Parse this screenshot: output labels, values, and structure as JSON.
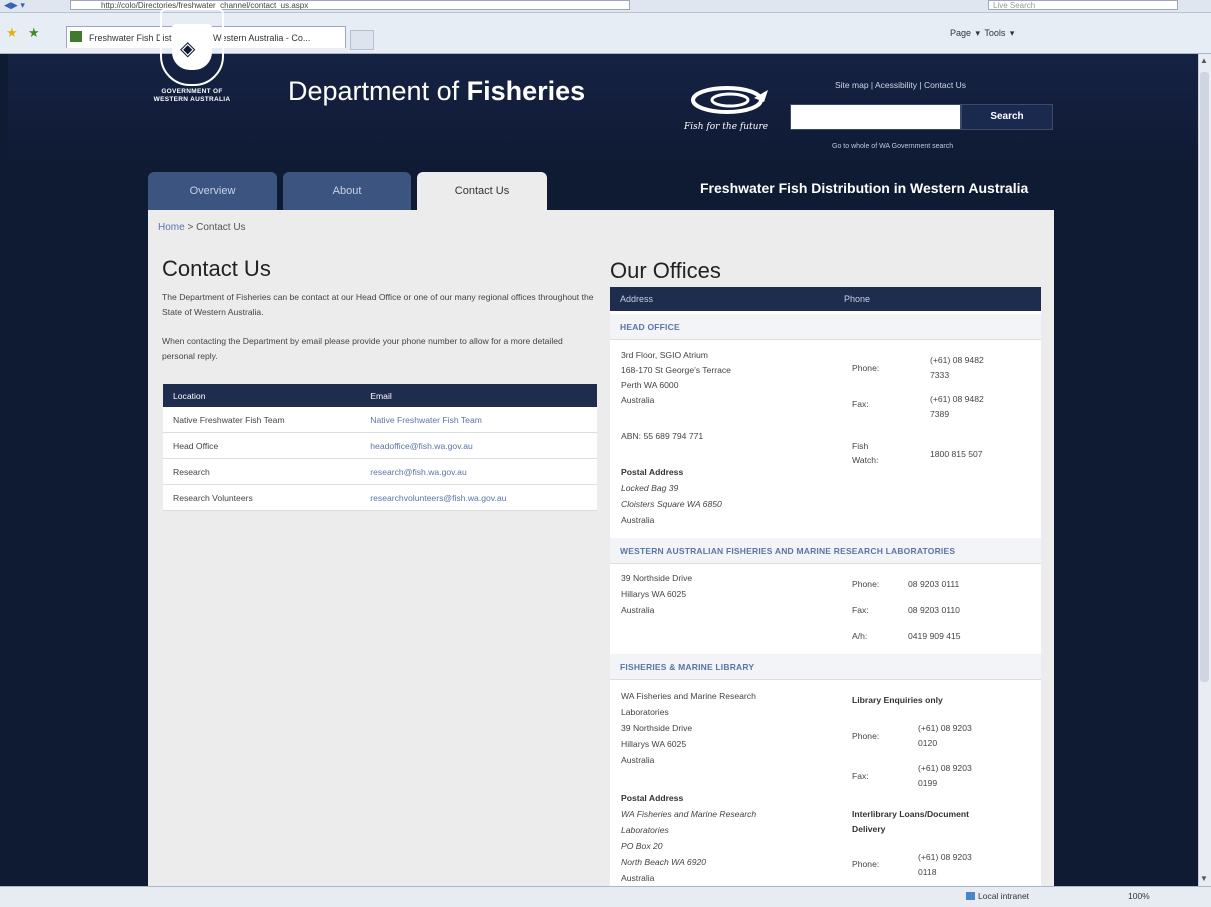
{
  "browser": {
    "url": "http://colo/Directories/freshwater_channel/contact_us.aspx",
    "live_search_placeholder": "Live Search",
    "tab_title": "Freshwater Fish Distribution in Western Australia - Co...",
    "command_bar": "Page ▾  Tools ▾",
    "status_zone": "Local intranet",
    "zoom": "100%"
  },
  "header": {
    "gov_line1": "GOVERNMENT OF",
    "gov_line2": "WESTERN AUSTRALIA",
    "dept_prefix": "Department of",
    "dept_bold": "Fisheries",
    "tagline": "Fish for the future",
    "top_links": "Site map | Acessibility | Contact Us",
    "search_button": "Search",
    "whole_gov_search": "Go to whole of WA Government search"
  },
  "nav": {
    "tabs": [
      "Overview",
      "About",
      "Contact Us"
    ],
    "site_title": "Freshwater Fish Distribution in Western Australia"
  },
  "breadcrumb": {
    "home": "Home",
    "sep": " > ",
    "current": "Contact Us"
  },
  "contact": {
    "heading": "Contact Us",
    "p1": "The Department of Fisheries can be contact at our Head Office or one of our many regional offices throughout the State of Western Australia.",
    "p2": "When contacting the Department by email please provide your phone number to allow for a more detailed personal reply.",
    "table_headers": [
      "Location",
      "Email"
    ],
    "rows": [
      [
        "Native Freshwater Fish Team",
        "Native Freshwater Fish Team"
      ],
      [
        "Head Office",
        "headoffice@fish.wa.gov.au"
      ],
      [
        "Research",
        "research@fish.wa.gov.au"
      ],
      [
        "Research Volunteers",
        "researchvolunteers@fish.wa.gov.au"
      ]
    ]
  },
  "offices": {
    "heading": "Our Offices",
    "headers": [
      "Address",
      "Phone"
    ],
    "head_office": {
      "title": "HEAD OFFICE",
      "addr": [
        "3rd Floor, SGIO Atrium",
        "168-170 St George's Terrace",
        "Perth WA 6000",
        "Australia"
      ],
      "abn": "ABN: 55 689 794 771",
      "postal_label": "Postal Address",
      "postal": [
        "Locked Bag 39",
        "Cloisters Square WA 6850"
      ],
      "postal_country": "Australia",
      "phone_label": "Phone:",
      "phone": [
        "(+61) 08 9482",
        "7333"
      ],
      "fax_label": "Fax:",
      "fax": [
        "(+61) 08 9482",
        "7389"
      ],
      "fishwatch_label": [
        "Fish",
        "Watch:"
      ],
      "fishwatch": "1800 815 507"
    },
    "labs": {
      "title": "WESTERN AUSTRALIAN FISHERIES AND MARINE RESEARCH LABORATORIES",
      "addr": [
        "39 Northside Drive",
        "Hillarys WA 6025",
        "Australia"
      ],
      "phone_label": "Phone:",
      "phone": "08 9203 0111",
      "fax_label": "Fax:",
      "fax": "08 9203 0110",
      "ah_label": "A/h:",
      "ah": "0419 909 415"
    },
    "library": {
      "title": "FISHERIES & MARINE LIBRARY",
      "addr": [
        "WA Fisheries and Marine Research",
        "Laboratories",
        "39 Northside Drive",
        "Hillarys WA 6025",
        "Australia"
      ],
      "postal_label": "Postal Address",
      "postal": [
        "WA Fisheries and Marine Research",
        "Laboratories",
        "PO Box 20",
        "North Beach WA 6920",
        "Australia"
      ],
      "enq_label": "Library Enquiries only",
      "phone_label": "Phone:",
      "phone": [
        "(+61) 08 9203",
        "0120"
      ],
      "fax_label": "Fax:",
      "fax": [
        "(+61) 08 9203",
        "0199"
      ],
      "loans_label": [
        "Interlibrary Loans/Document",
        "Delivery"
      ],
      "loans_phone_label": "Phone:",
      "loans_phone": [
        "(+61) 08 9203",
        "0118"
      ]
    }
  }
}
